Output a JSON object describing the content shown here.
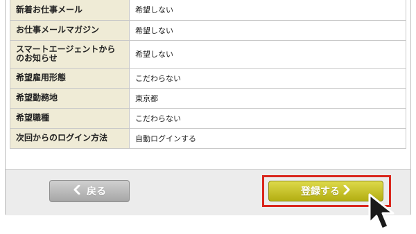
{
  "settings": {
    "rows": [
      {
        "label": "新着お仕事メール",
        "value": "希望しない"
      },
      {
        "label": "お仕事メールマガジン",
        "value": "希望しない"
      },
      {
        "label": "スマートエージェントからのお知らせ",
        "value": "希望しない"
      },
      {
        "label": "希望雇用形態",
        "value": "こだわらない"
      },
      {
        "label": "希望勤務地",
        "value": "東京都"
      },
      {
        "label": "希望職種",
        "value": "こだわらない"
      },
      {
        "label": "次回からのログイン方法",
        "value": "自動ログインする"
      }
    ]
  },
  "footer": {
    "back_label": "戻る",
    "submit_label": "登録する"
  },
  "colors": {
    "label_bg": "#efebd6",
    "submit_button": "#c9c42a",
    "highlight_border": "#d9261c"
  },
  "icons": {
    "back": "chevron-left-icon",
    "submit": "chevron-right-icon",
    "cursor": "mouse-pointer-icon"
  }
}
